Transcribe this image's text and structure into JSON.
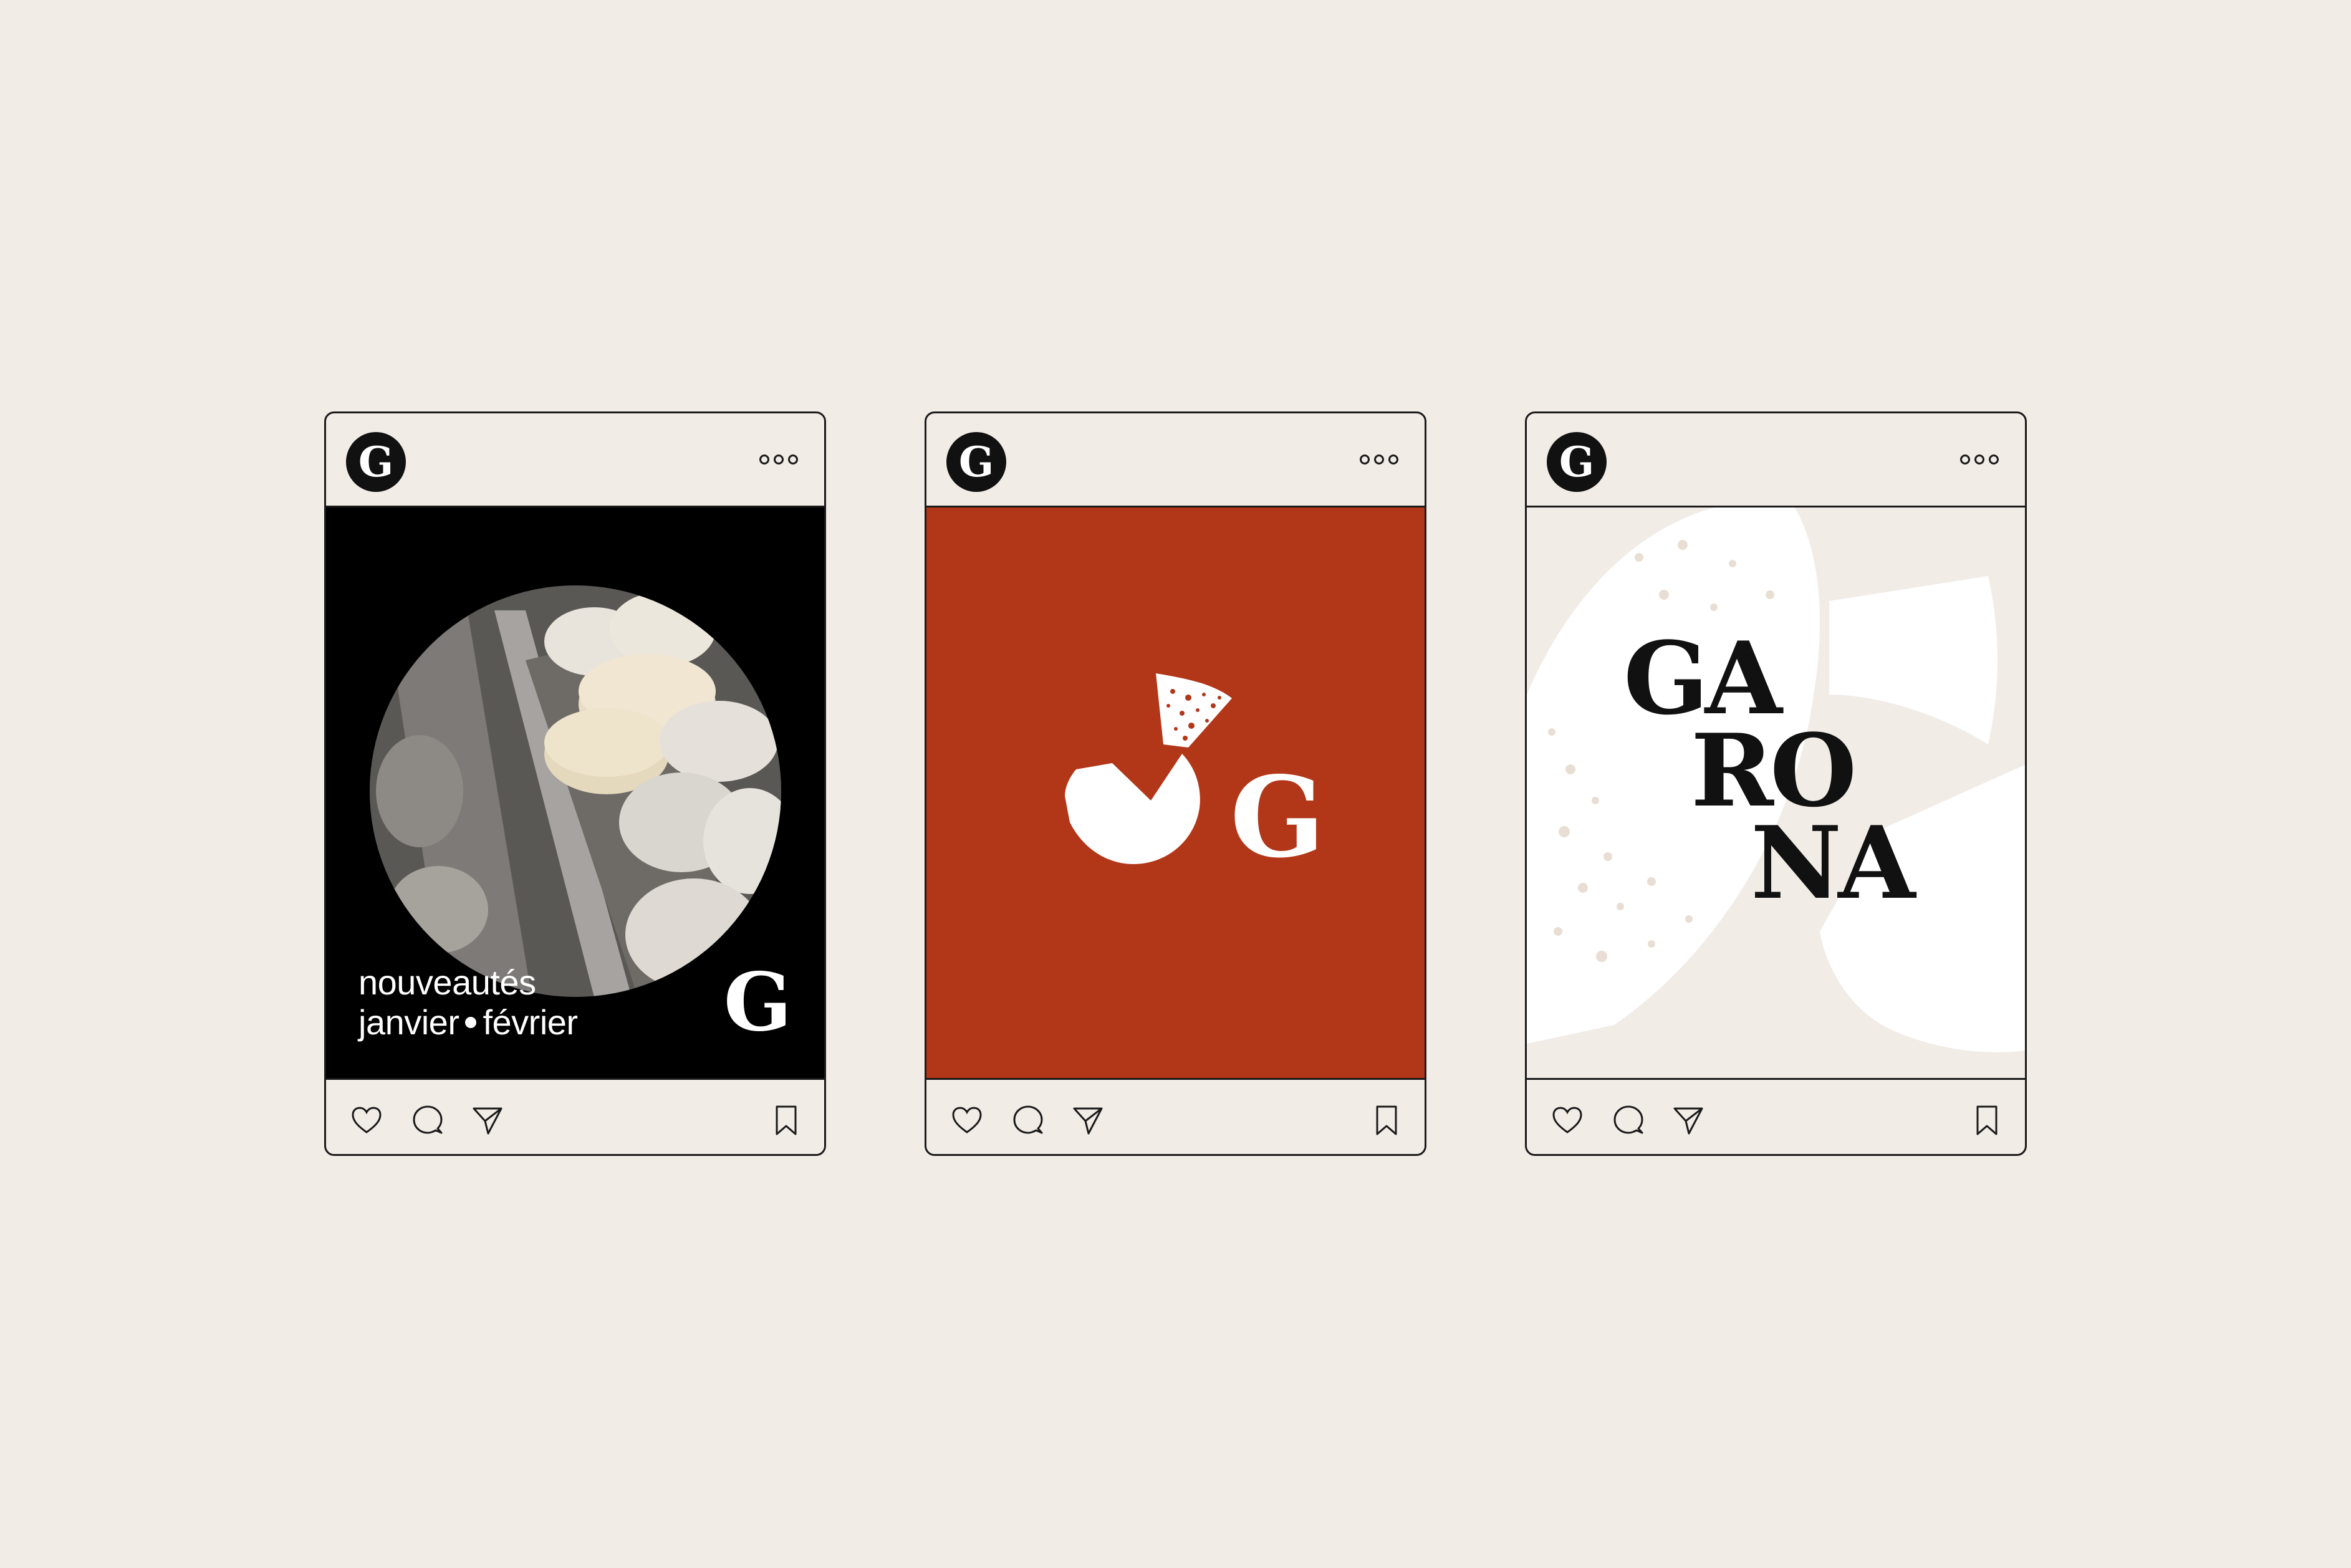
{
  "colors": {
    "background": "#f2ece7",
    "outline": "#1a1a1a",
    "brand_red": "#b23618",
    "black": "#000000",
    "white": "#ffffff"
  },
  "posts": [
    {
      "avatar_letter": "G",
      "more_icon": "more-dots-icon",
      "media": {
        "caption_line1": "nouveautés",
        "caption_line2_a": "janvier",
        "caption_line2_b": "février",
        "brand_letter": "G"
      },
      "actions": [
        "heart-icon",
        "comment-icon",
        "share-icon",
        "bookmark-icon"
      ]
    },
    {
      "avatar_letter": "G",
      "more_icon": "more-dots-icon",
      "media": {
        "logo_letter": "G"
      },
      "actions": [
        "heart-icon",
        "comment-icon",
        "share-icon",
        "bookmark-icon"
      ]
    },
    {
      "avatar_letter": "G",
      "more_icon": "more-dots-icon",
      "media": {
        "wordmark_line1": "GA",
        "wordmark_line2": "RO",
        "wordmark_line3": "NA"
      },
      "actions": [
        "heart-icon",
        "comment-icon",
        "share-icon",
        "bookmark-icon"
      ]
    }
  ]
}
